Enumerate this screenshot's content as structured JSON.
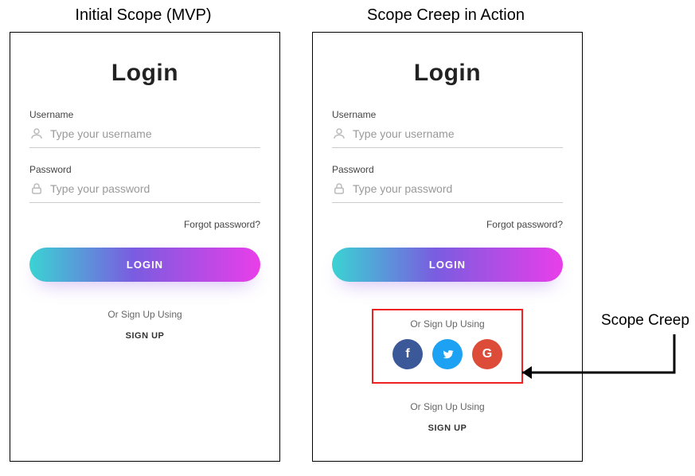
{
  "titles": {
    "left": "Initial Scope (MVP)",
    "right": "Scope Creep in Action"
  },
  "callout_label": "Scope Creep",
  "login": {
    "heading": "Login",
    "username_label": "Username",
    "username_placeholder": "Type your username",
    "password_label": "Password",
    "password_placeholder": "Type your password",
    "forgot_label": "Forgot password?",
    "login_button": "LOGIN",
    "alt_signup_label": "Or Sign Up Using",
    "signup_text": "SIGN UP",
    "social": {
      "facebook_glyph": "f",
      "twitter_glyph": "",
      "google_glyph": "G"
    }
  },
  "colors": {
    "gradient_start": "#3ad3d3",
    "gradient_mid": "#7a5ce0",
    "gradient_end": "#e93ee9",
    "fb": "#3b5998",
    "tw": "#1da1f2",
    "gg": "#dd4b39",
    "highlight_box": "#e22"
  }
}
